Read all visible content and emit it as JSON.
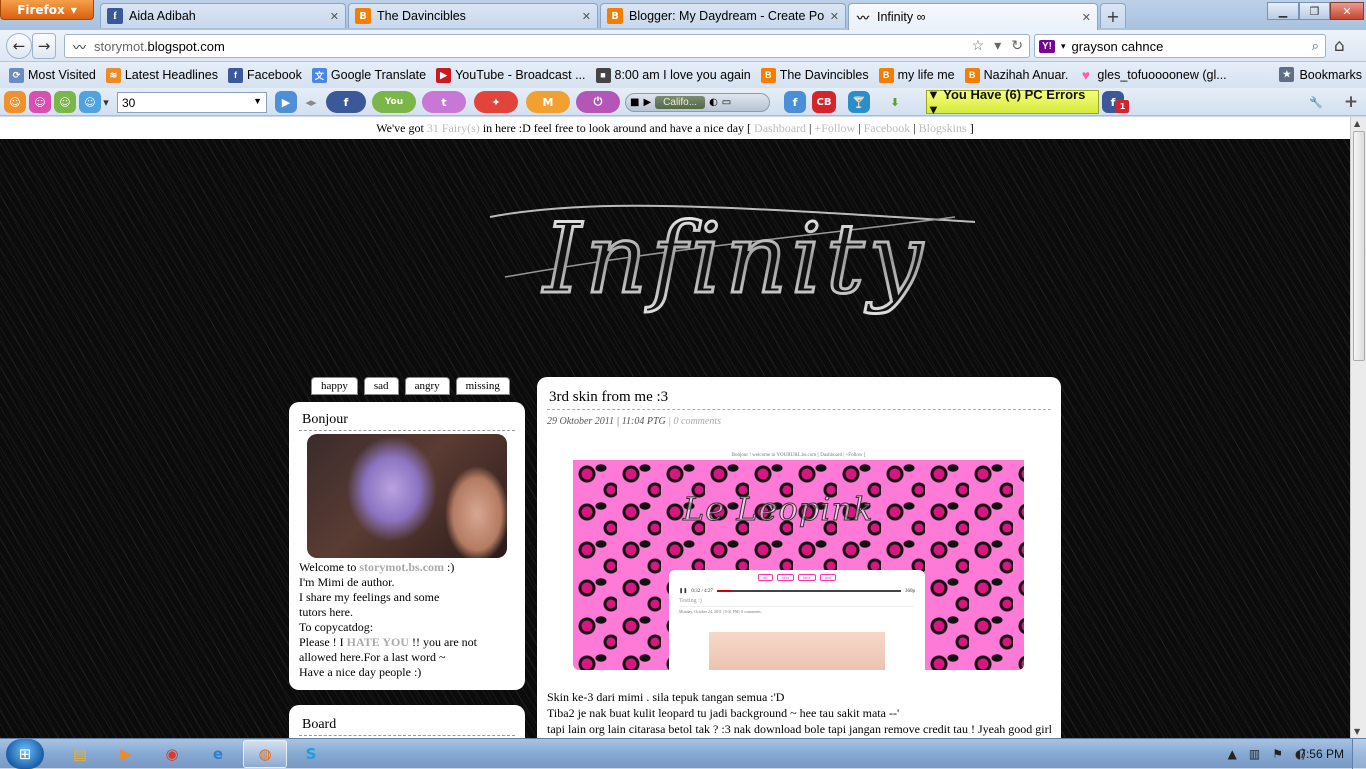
{
  "browser": {
    "menu_button": "Firefox",
    "tabs": [
      {
        "label": "Aida Adibah",
        "favicon": "facebook-icon"
      },
      {
        "label": "The Davincibles",
        "favicon": "blogger-icon"
      },
      {
        "label": "Blogger: My Daydream - Create Post",
        "favicon": "blogger-icon"
      },
      {
        "label": "Infinity ∞",
        "favicon": "mustache-icon",
        "active": true
      }
    ],
    "url_host_prefix": "storymot.",
    "url_domain": "blogspot.com",
    "search_value": "grayson cahnce",
    "bookmarks": [
      {
        "label": "Most Visited"
      },
      {
        "label": "Latest Headlines"
      },
      {
        "label": "Facebook"
      },
      {
        "label": "Google Translate"
      },
      {
        "label": "YouTube - Broadcast ..."
      },
      {
        "label": "8:00 am I love you again"
      },
      {
        "label": "The Davincibles"
      },
      {
        "label": "my life me"
      },
      {
        "label": "Nazihah Anuar."
      },
      {
        "label": "gles_tofuoooonew (gl..."
      }
    ],
    "bookmarks_menu": "Bookmarks",
    "toolbar": {
      "select_value": "30",
      "player_station": "Califo...",
      "pc_errors": "▼ You Have (6) PC Errors ▼",
      "cb_label": "CB",
      "m_label": "M",
      "fb_badge": "1"
    }
  },
  "page": {
    "topbar": {
      "prefix": "We've got",
      "count": "31 Fairy(s)",
      "suffix": "in here :D feel free to look around and have a nice day [",
      "links": [
        "Dashboard",
        "+Follow",
        "Facebook",
        "Blogskins"
      ],
      "sep": "|",
      "close": "]"
    },
    "logo_text": "Infinity",
    "moods": [
      "happy",
      "sad",
      "angry",
      "missing"
    ],
    "sidebar": {
      "title": "Bonjour",
      "welcome_prefix": "Welcome to",
      "welcome_site": "storymot.bs.com",
      "welcome_suffix": ":)",
      "lines": [
        "I'm Mimi de author.",
        "I share my feelings and some",
        "tutors here.",
        "To copycatdog:"
      ],
      "please_prefix": "Please ! I",
      "hate": "HATE YOU",
      "please_suffix": "!! you are not",
      "lines2": [
        "allowed here.For a last word ~",
        "Have a nice day people :)"
      ],
      "board_title": "Board"
    },
    "post": {
      "title": "3rd skin from me :3",
      "date": "29 Oktober 2011 | 11:04 PTG",
      "comments": "0 comments",
      "image_header": "Bonjour ! welcome to YOURURL.bs.com [ Dashboard | +Follow ]",
      "image_title": "Le Leopink",
      "image_tabs": [
        "tab",
        "tutor",
        "tutor",
        "post"
      ],
      "image_time": "0:32 / 4:27",
      "image_quality": "360p",
      "image_text": "Testing :)",
      "image_sub": "Monday, October 24, 2011 | 9:31 PM | 0 comments",
      "body": [
        "Skin ke-3 dari mimi . sila tepuk tangan semua :'D",
        "Tiba2 je nak buat kulit leopard tu jadi background ~ hee tau sakit mata --'",
        "tapi lain org lain citarasa betol tak ? :3 nak download bole tapi jangan remove credit tau ! Jyeah good girl"
      ]
    }
  },
  "taskbar": {
    "time": "7:56 PM"
  }
}
